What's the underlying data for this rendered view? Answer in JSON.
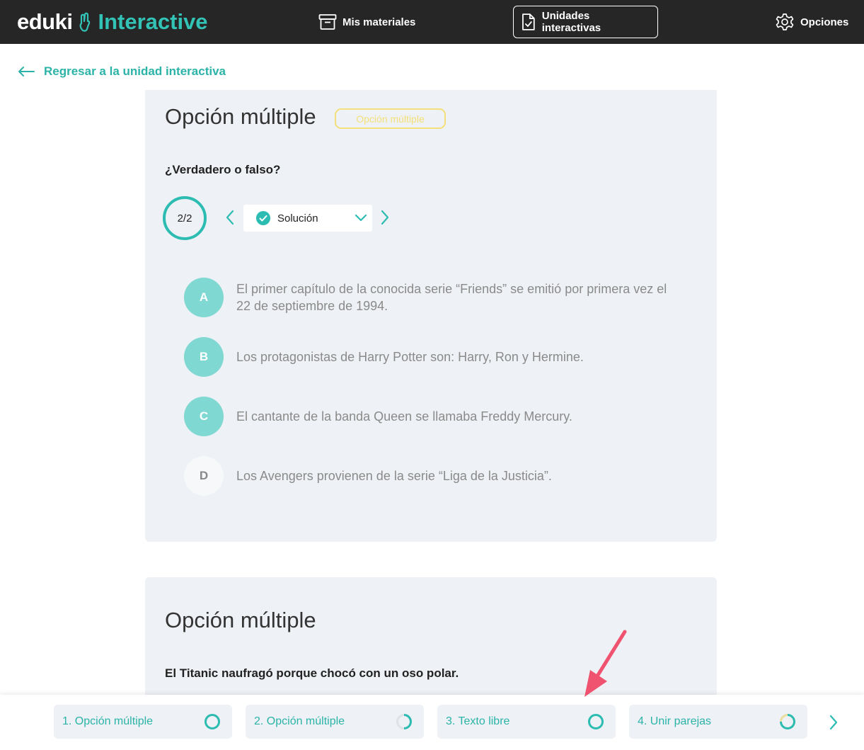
{
  "header": {
    "logo_part1": "eduki",
    "logo_part2": "Interactive",
    "nav_materials": "Mis materiales",
    "nav_units": "Unidades interactivas",
    "nav_options": "Opciones"
  },
  "back_link": "Regresar a la unidad interactiva",
  "card1": {
    "title": "Opción múltiple",
    "badge": "Opción múltiple",
    "question": "¿Verdadero o falso?",
    "progress": "2/2",
    "selector_value": "Solución",
    "answers": [
      {
        "letter": "A",
        "text": "El primer capítulo de la conocida serie “Friends” se emitió por primera vez el 22 de septiembre de 1994."
      },
      {
        "letter": "B",
        "text": "Los protagonistas de Harry Potter son: Harry, Ron y Hermine."
      },
      {
        "letter": "C",
        "text": "El cantante de la banda Queen se llamaba Freddy Mercury."
      },
      {
        "letter": "D",
        "text": "Los Avengers provienen de la serie “Liga de la Justicia”."
      }
    ]
  },
  "card2": {
    "title": "Opción múltiple",
    "question": "El Titanic naufragó porque chocó con un oso polar."
  },
  "steps": [
    {
      "label": "1. Opción múltiple",
      "progress": 0
    },
    {
      "label": "2. Opción múltiple",
      "progress": 0.5
    },
    {
      "label": "3. Texto libre",
      "progress": 0
    },
    {
      "label": "4. Unir parejas",
      "progress": 0.75
    }
  ],
  "colors": {
    "accent": "#2cbcb2",
    "topbar": "#262626",
    "card_bg": "#eef1f5",
    "badge": "#f4e07a",
    "annotation_arrow": "#f0536f"
  }
}
